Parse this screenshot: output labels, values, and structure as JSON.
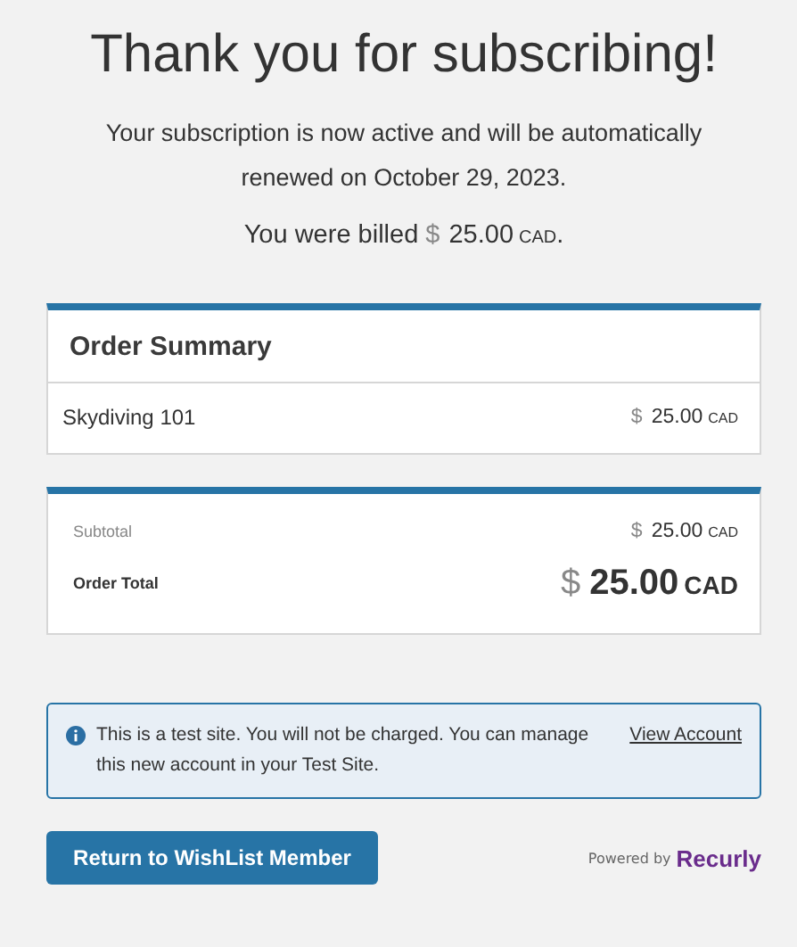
{
  "heading": "Thank you for subscribing!",
  "message": "Your subscription is now active and will be automatically renewed on October 29, 2023.",
  "billed": {
    "prefix": "You were billed",
    "price": {
      "symbol": "$",
      "amount": "25.00",
      "currency": "CAD"
    },
    "suffix": "."
  },
  "order_summary": {
    "title": "Order Summary",
    "items": [
      {
        "name": "Skydiving 101",
        "price": {
          "symbol": "$",
          "amount": "25.00",
          "currency": "CAD"
        }
      }
    ]
  },
  "totals": [
    {
      "kind": "subtotal",
      "label": "Subtotal",
      "price": {
        "symbol": "$",
        "amount": "25.00",
        "currency": "CAD"
      }
    },
    {
      "kind": "total",
      "label": "Order Total",
      "price": {
        "symbol": "$",
        "amount": "25.00",
        "currency": "CAD"
      }
    }
  ],
  "notice": {
    "text": "This is a test site. You will not be charged. You can manage this new account in your Test Site.",
    "link": "View Account"
  },
  "return_button": "Return to WishList Member",
  "powered_by": {
    "label": "Powered by",
    "brand": "Recurly"
  }
}
